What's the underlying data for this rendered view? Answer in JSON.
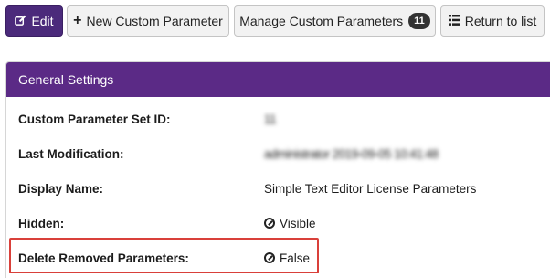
{
  "toolbar": {
    "edit_label": "Edit",
    "new_param_label": "New Custom Parameter",
    "manage_label": "Manage Custom Parameters",
    "manage_count": "11",
    "return_label": "Return to list"
  },
  "panel": {
    "title": "General Settings",
    "rows": [
      {
        "label": "Custom Parameter Set ID:",
        "value": "11"
      },
      {
        "label": "Last Modification:",
        "value": "administrator 2019-09-05 10:41:48"
      },
      {
        "label": "Display Name:",
        "value": "Simple Text Editor License Parameters"
      },
      {
        "label": "Hidden:",
        "value": "Visible"
      },
      {
        "label": "Delete Removed Parameters:",
        "value": "False"
      }
    ]
  },
  "colors": {
    "primary": "#4b2a7b",
    "panel_header": "#5b2a86",
    "highlight": "#d9403a"
  },
  "icons": {
    "edit": "pencil-square-icon",
    "new": "plus-icon",
    "return": "list-icon",
    "hidden": "ban-icon",
    "delete_removed": "ban-icon"
  }
}
